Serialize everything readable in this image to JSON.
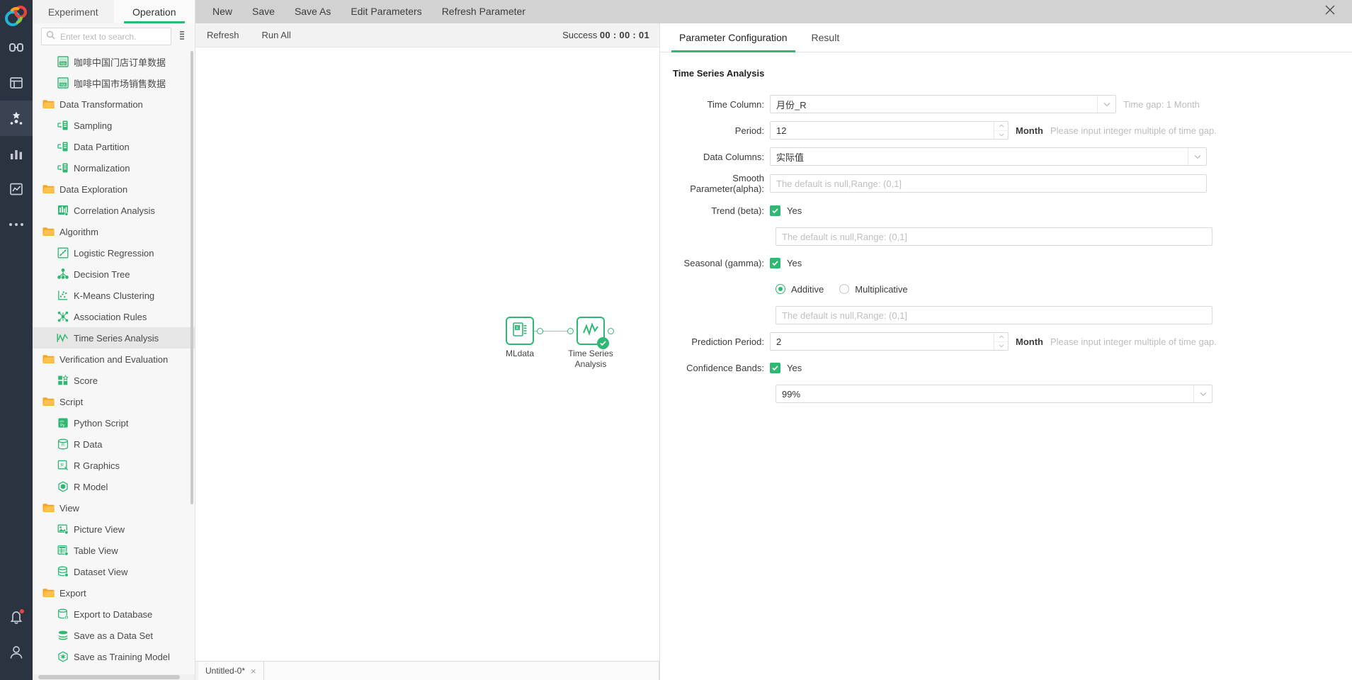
{
  "rail": {
    "items": [
      {
        "name": "logo",
        "icon": "app-logo"
      },
      {
        "name": "link",
        "icon": "link-icon"
      },
      {
        "name": "data",
        "icon": "database-icon"
      },
      {
        "name": "tools",
        "icon": "tools-icon"
      },
      {
        "name": "chart",
        "icon": "bar-chart-icon"
      },
      {
        "name": "analysis",
        "icon": "analysis-icon"
      },
      {
        "name": "more",
        "icon": "more-icon"
      },
      {
        "name": "alerts",
        "icon": "bell-icon"
      },
      {
        "name": "user",
        "icon": "user-icon"
      }
    ]
  },
  "sidebar": {
    "tabs": [
      {
        "label": "Experiment",
        "active": false
      },
      {
        "label": "Operation",
        "active": true
      }
    ],
    "search": {
      "placeholder": "Enter text to search.",
      "value": ""
    },
    "tree": [
      {
        "label": "咖啡中国门店订单数据",
        "type": "leaf",
        "icon": "sql-dataset-icon",
        "selected": false
      },
      {
        "label": "咖啡中国市场销售数据",
        "type": "leaf",
        "icon": "sql-dataset-icon",
        "selected": false
      },
      {
        "label": "Data Transformation",
        "type": "folder",
        "icon": "folder-icon",
        "selected": false
      },
      {
        "label": "Sampling",
        "type": "leaf",
        "icon": "table-green-icon",
        "selected": false
      },
      {
        "label": "Data Partition",
        "type": "leaf",
        "icon": "table-green-icon",
        "selected": false
      },
      {
        "label": "Normalization",
        "type": "leaf",
        "icon": "table-green-icon",
        "selected": false
      },
      {
        "label": "Data Exploration",
        "type": "folder",
        "icon": "folder-icon",
        "selected": false
      },
      {
        "label": "Correlation Analysis",
        "type": "leaf",
        "icon": "histogram-icon",
        "selected": false
      },
      {
        "label": "Algorithm",
        "type": "folder",
        "icon": "folder-icon",
        "selected": false
      },
      {
        "label": "Logistic Regression",
        "type": "leaf",
        "icon": "regression-icon",
        "selected": false
      },
      {
        "label": "Decision Tree",
        "type": "leaf",
        "icon": "tree-icon",
        "selected": false
      },
      {
        "label": "K-Means Clustering",
        "type": "leaf",
        "icon": "scatter-icon",
        "selected": false
      },
      {
        "label": "Association Rules",
        "type": "leaf",
        "icon": "network-icon",
        "selected": false
      },
      {
        "label": "Time Series Analysis",
        "type": "leaf",
        "icon": "timeseries-icon",
        "selected": true
      },
      {
        "label": "Verification and Evaluation",
        "type": "folder",
        "icon": "folder-icon",
        "selected": false
      },
      {
        "label": "Score",
        "type": "leaf",
        "icon": "score-icon",
        "selected": false
      },
      {
        "label": "Script",
        "type": "folder",
        "icon": "folder-icon",
        "selected": false
      },
      {
        "label": "Python Script",
        "type": "leaf",
        "icon": "python-icon",
        "selected": false
      },
      {
        "label": "R Data",
        "type": "leaf",
        "icon": "r-data-icon",
        "selected": false
      },
      {
        "label": "R Graphics",
        "type": "leaf",
        "icon": "r-graphics-icon",
        "selected": false
      },
      {
        "label": "R Model",
        "type": "leaf",
        "icon": "r-model-icon",
        "selected": false
      },
      {
        "label": "View",
        "type": "folder",
        "icon": "folder-icon",
        "selected": false
      },
      {
        "label": "Picture View",
        "type": "leaf",
        "icon": "picture-icon",
        "selected": false
      },
      {
        "label": "Table View",
        "type": "leaf",
        "icon": "table-view-icon",
        "selected": false
      },
      {
        "label": "Dataset View",
        "type": "leaf",
        "icon": "dataset-icon",
        "selected": false
      },
      {
        "label": "Export",
        "type": "folder",
        "icon": "folder-icon",
        "selected": false
      },
      {
        "label": "Export to Database",
        "type": "leaf",
        "icon": "export-db-icon",
        "selected": false
      },
      {
        "label": "Save as a Data Set",
        "type": "leaf",
        "icon": "stack-icon",
        "selected": false
      },
      {
        "label": "Save as Training Model",
        "type": "leaf",
        "icon": "model-icon",
        "selected": false
      }
    ]
  },
  "menubar": {
    "items": [
      "New",
      "Save",
      "Save As",
      "Edit Parameters",
      "Refresh Parameter"
    ],
    "close_label": "×"
  },
  "canvas_toolbar": {
    "items": [
      "Refresh",
      "Run All"
    ],
    "status_label": "Success",
    "status_time": "00 : 00 : 01"
  },
  "canvas": {
    "nodes": [
      {
        "label": "MLdata",
        "icon": "excel-dataset-icon",
        "status": ""
      },
      {
        "label": "Time Series Analysis",
        "icon": "timeseries-node-icon",
        "status": "ok"
      }
    ]
  },
  "bottom_tabs": [
    {
      "label": "Untitled-0*",
      "close": "×"
    }
  ],
  "props": {
    "tabs": [
      {
        "label": "Parameter Configuration",
        "active": true
      },
      {
        "label": "Result",
        "active": false
      }
    ],
    "section_title": "Time Series Analysis",
    "fields": {
      "time_column": {
        "label": "Time Column:",
        "value": "月份_R",
        "hint": "Time gap: 1 Month"
      },
      "period": {
        "label": "Period:",
        "value": "12",
        "unit": "Month",
        "hint": "Please input integer multiple of time gap."
      },
      "data_columns": {
        "label": "Data Columns:",
        "value": "实际值"
      },
      "smooth_alpha": {
        "label": "Smooth Parameter(alpha):",
        "placeholder": "The default is null,Range: (0,1]",
        "value": ""
      },
      "trend_beta": {
        "label": "Trend (beta):",
        "checked_label": "Yes",
        "checked": true,
        "placeholder": "The default is null,Range: (0,1]",
        "value": ""
      },
      "seasonal_gamma": {
        "label": "Seasonal (gamma):",
        "checked_label": "Yes",
        "checked": true,
        "options": [
          {
            "label": "Additive",
            "selected": true
          },
          {
            "label": "Multiplicative",
            "selected": false
          }
        ],
        "placeholder": "The default is null,Range: (0,1]",
        "value": ""
      },
      "prediction_period": {
        "label": "Prediction Period:",
        "value": "2",
        "unit": "Month",
        "hint": "Please input integer multiple of time gap."
      },
      "confidence_bands": {
        "label": "Confidence Bands:",
        "checked_label": "Yes",
        "checked": true,
        "value": "99%"
      }
    }
  },
  "colors": {
    "accent_green": "#2eb872",
    "rail_bg": "#2c3340",
    "menubar_bg": "#d2d2d2",
    "sidebar_bg": "#f7f7f7"
  }
}
